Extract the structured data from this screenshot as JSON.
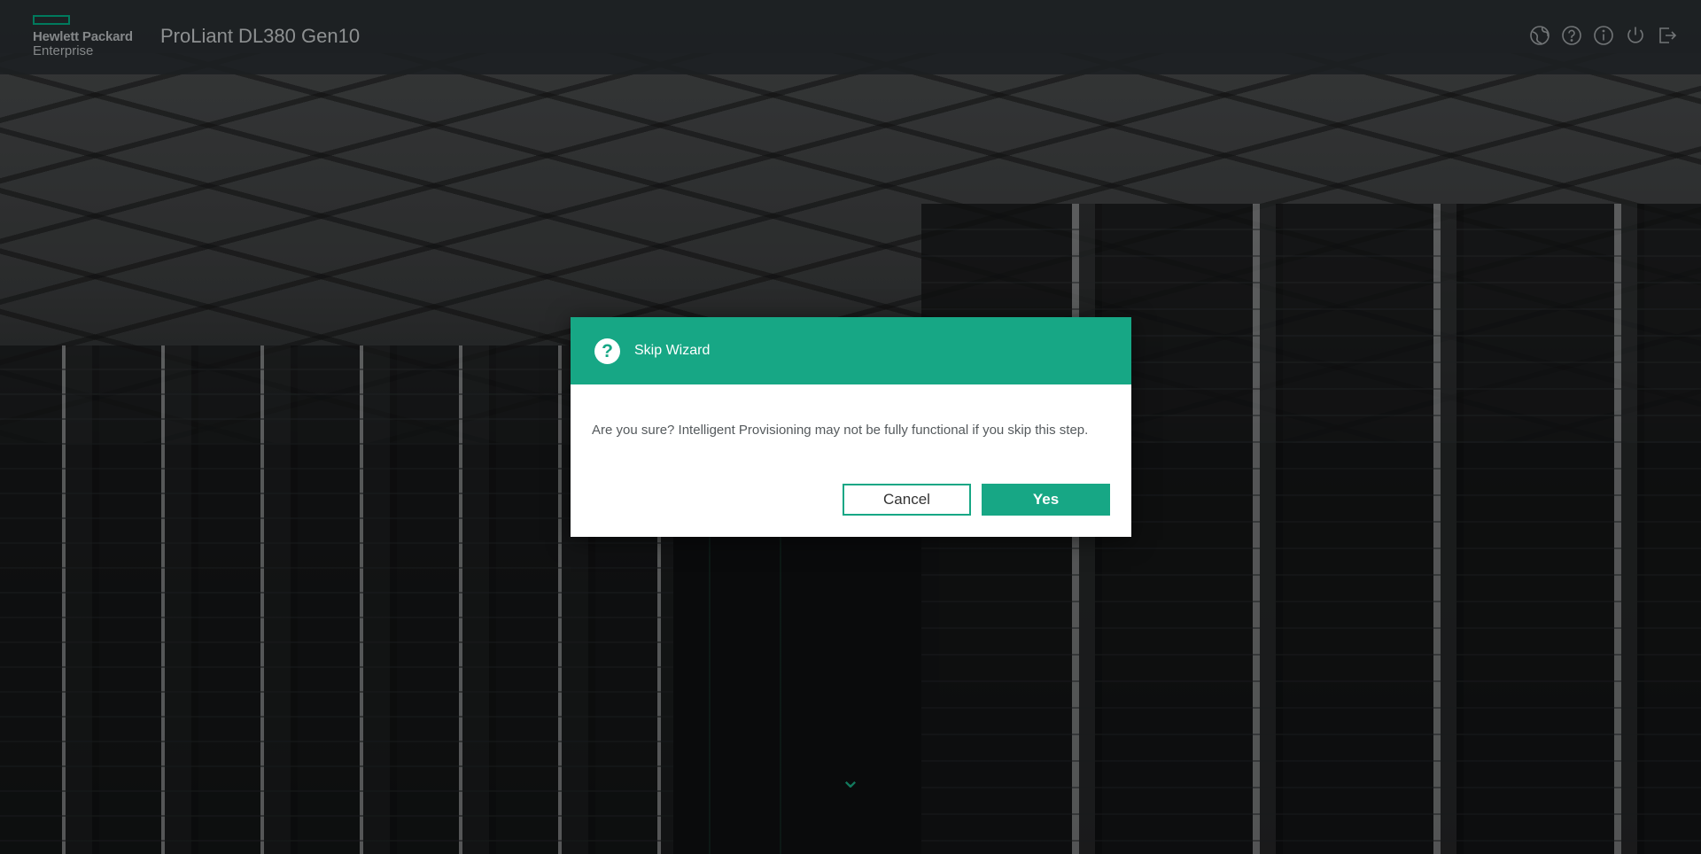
{
  "header": {
    "brand_line1": "Hewlett Packard",
    "brand_line2": "Enterprise",
    "product": "ProLiant DL380 Gen10",
    "icons": [
      "globe-icon",
      "help-icon",
      "info-icon",
      "power-icon",
      "logout-icon"
    ]
  },
  "dialog": {
    "icon": "question-icon",
    "title": "Skip Wizard",
    "message": "Are you sure? Intelligent Provisioning may not be fully functional if you skip this step.",
    "cancel_label": "Cancel",
    "yes_label": "Yes"
  },
  "colors": {
    "accent": "#17a785",
    "header_bg": "#282c30",
    "logo_green": "#01a982"
  }
}
